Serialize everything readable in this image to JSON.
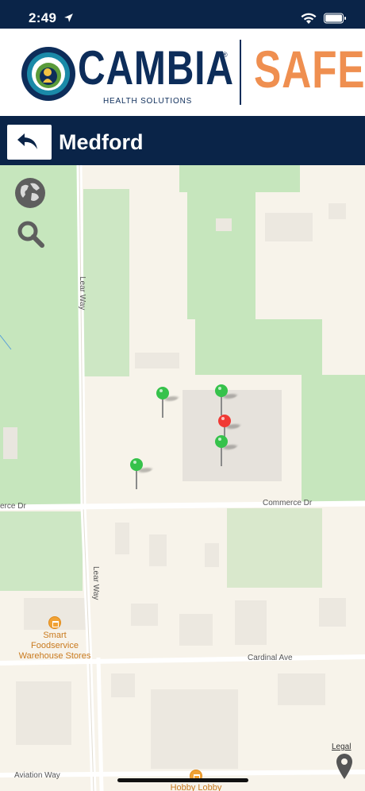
{
  "status_bar": {
    "time": "2:49"
  },
  "brand": {
    "name": "CAMBIA",
    "registered_mark": "®",
    "subtitle": "HEALTH SOLUTIONS",
    "product": "SAFE",
    "colors": {
      "navy": "#0a2448",
      "orange": "#ef8f50"
    }
  },
  "nav": {
    "title": "Medford",
    "back_icon": "back-arrow-icon"
  },
  "map": {
    "streets": {
      "lear_way_top": "Lear Way",
      "lear_way_bottom": "Lear Way",
      "commerce_dr_left": "erce Dr",
      "commerce_dr_right": "Commerce Dr",
      "cardinal_ave": "Cardinal Ave",
      "aviation_way": "Aviation Way"
    },
    "pois": {
      "smart_foodservice": "Smart\nFoodservice\nWarehouse Stores",
      "hobby_lobby": "Hobby Lobby"
    },
    "legal": "Legal",
    "pins": [
      {
        "color": "green"
      },
      {
        "color": "green"
      },
      {
        "color": "red"
      },
      {
        "color": "green"
      },
      {
        "color": "green"
      }
    ],
    "pin_colors": {
      "green": "#36c24b",
      "red": "#f03a35"
    }
  }
}
